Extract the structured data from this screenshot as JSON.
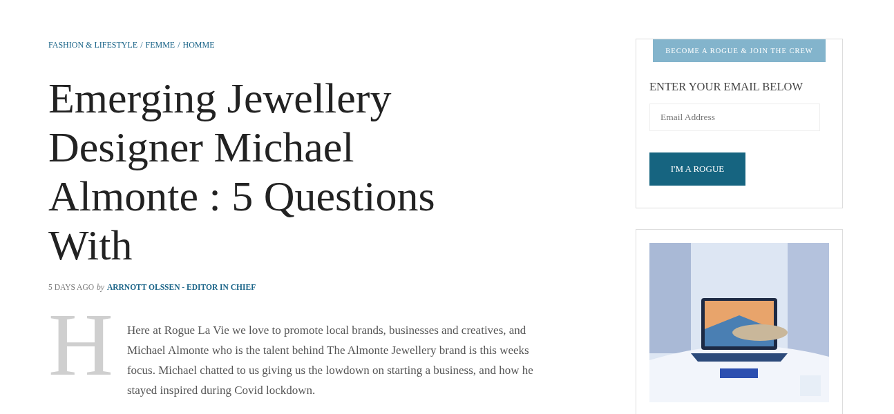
{
  "breadcrumb": {
    "items": [
      "FASHION & LIFESTYLE",
      "FEMME",
      "HOMME"
    ],
    "separator": "/"
  },
  "article": {
    "title": "Emerging Jewellery Designer Michael Almonte : 5 Questions With",
    "date": "5 DAYS AGO",
    "by": "by",
    "author": "ARRNOTT OLSSEN - EDITOR IN CHIEF",
    "drop_cap": "H",
    "intro": "Here at Rogue La Vie we love to promote local brands, businesses and creatives, and Michael Almonte who is the talent behind The Almonte Jewellery brand is this weeks focus. Michael chatted to us giving us the lowdown on starting a business, and how he stayed inspired during Covid lockdown."
  },
  "signup": {
    "banner": "BECOME A ROGUE & JOIN THE CREW",
    "heading": "ENTER YOUR EMAIL BELOW",
    "placeholder": "Email Address",
    "button": "I'M A ROGUE"
  }
}
